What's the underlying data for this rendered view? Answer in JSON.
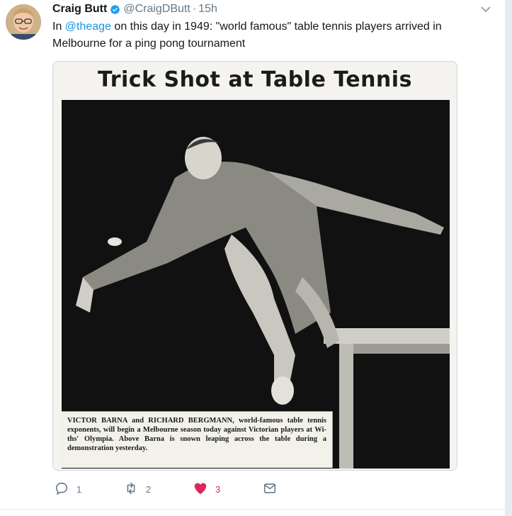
{
  "tweet": {
    "author_name": "Craig Butt",
    "author_handle": "@CraigDButt",
    "separator": "·",
    "time": "15h",
    "text_before": "In ",
    "mention": "@theage",
    "text_after": " on this day in 1949: \"world famous\" table tennis players arrived in Melbourne for a ping pong tournament"
  },
  "media": {
    "headline": "Trick Shot at Table Tennis",
    "caption": "VICTOR BARNA and RICHARD BERGMANN, world-famous table tennis exponents, will begin a Melbourne season today against Victorian players at Wi-ths' Olympia. Above Barna is snown leaping across the table during a demonstration yesterday."
  },
  "actions": {
    "reply_count": "1",
    "retweet_count": "2",
    "like_count": "3"
  },
  "colors": {
    "accent": "#1b95e0",
    "like": "#e0245e",
    "muted": "#657786"
  },
  "icons": [
    "verified-badge-icon",
    "chevron-down-icon",
    "reply-icon",
    "retweet-icon",
    "heart-icon",
    "message-icon"
  ]
}
